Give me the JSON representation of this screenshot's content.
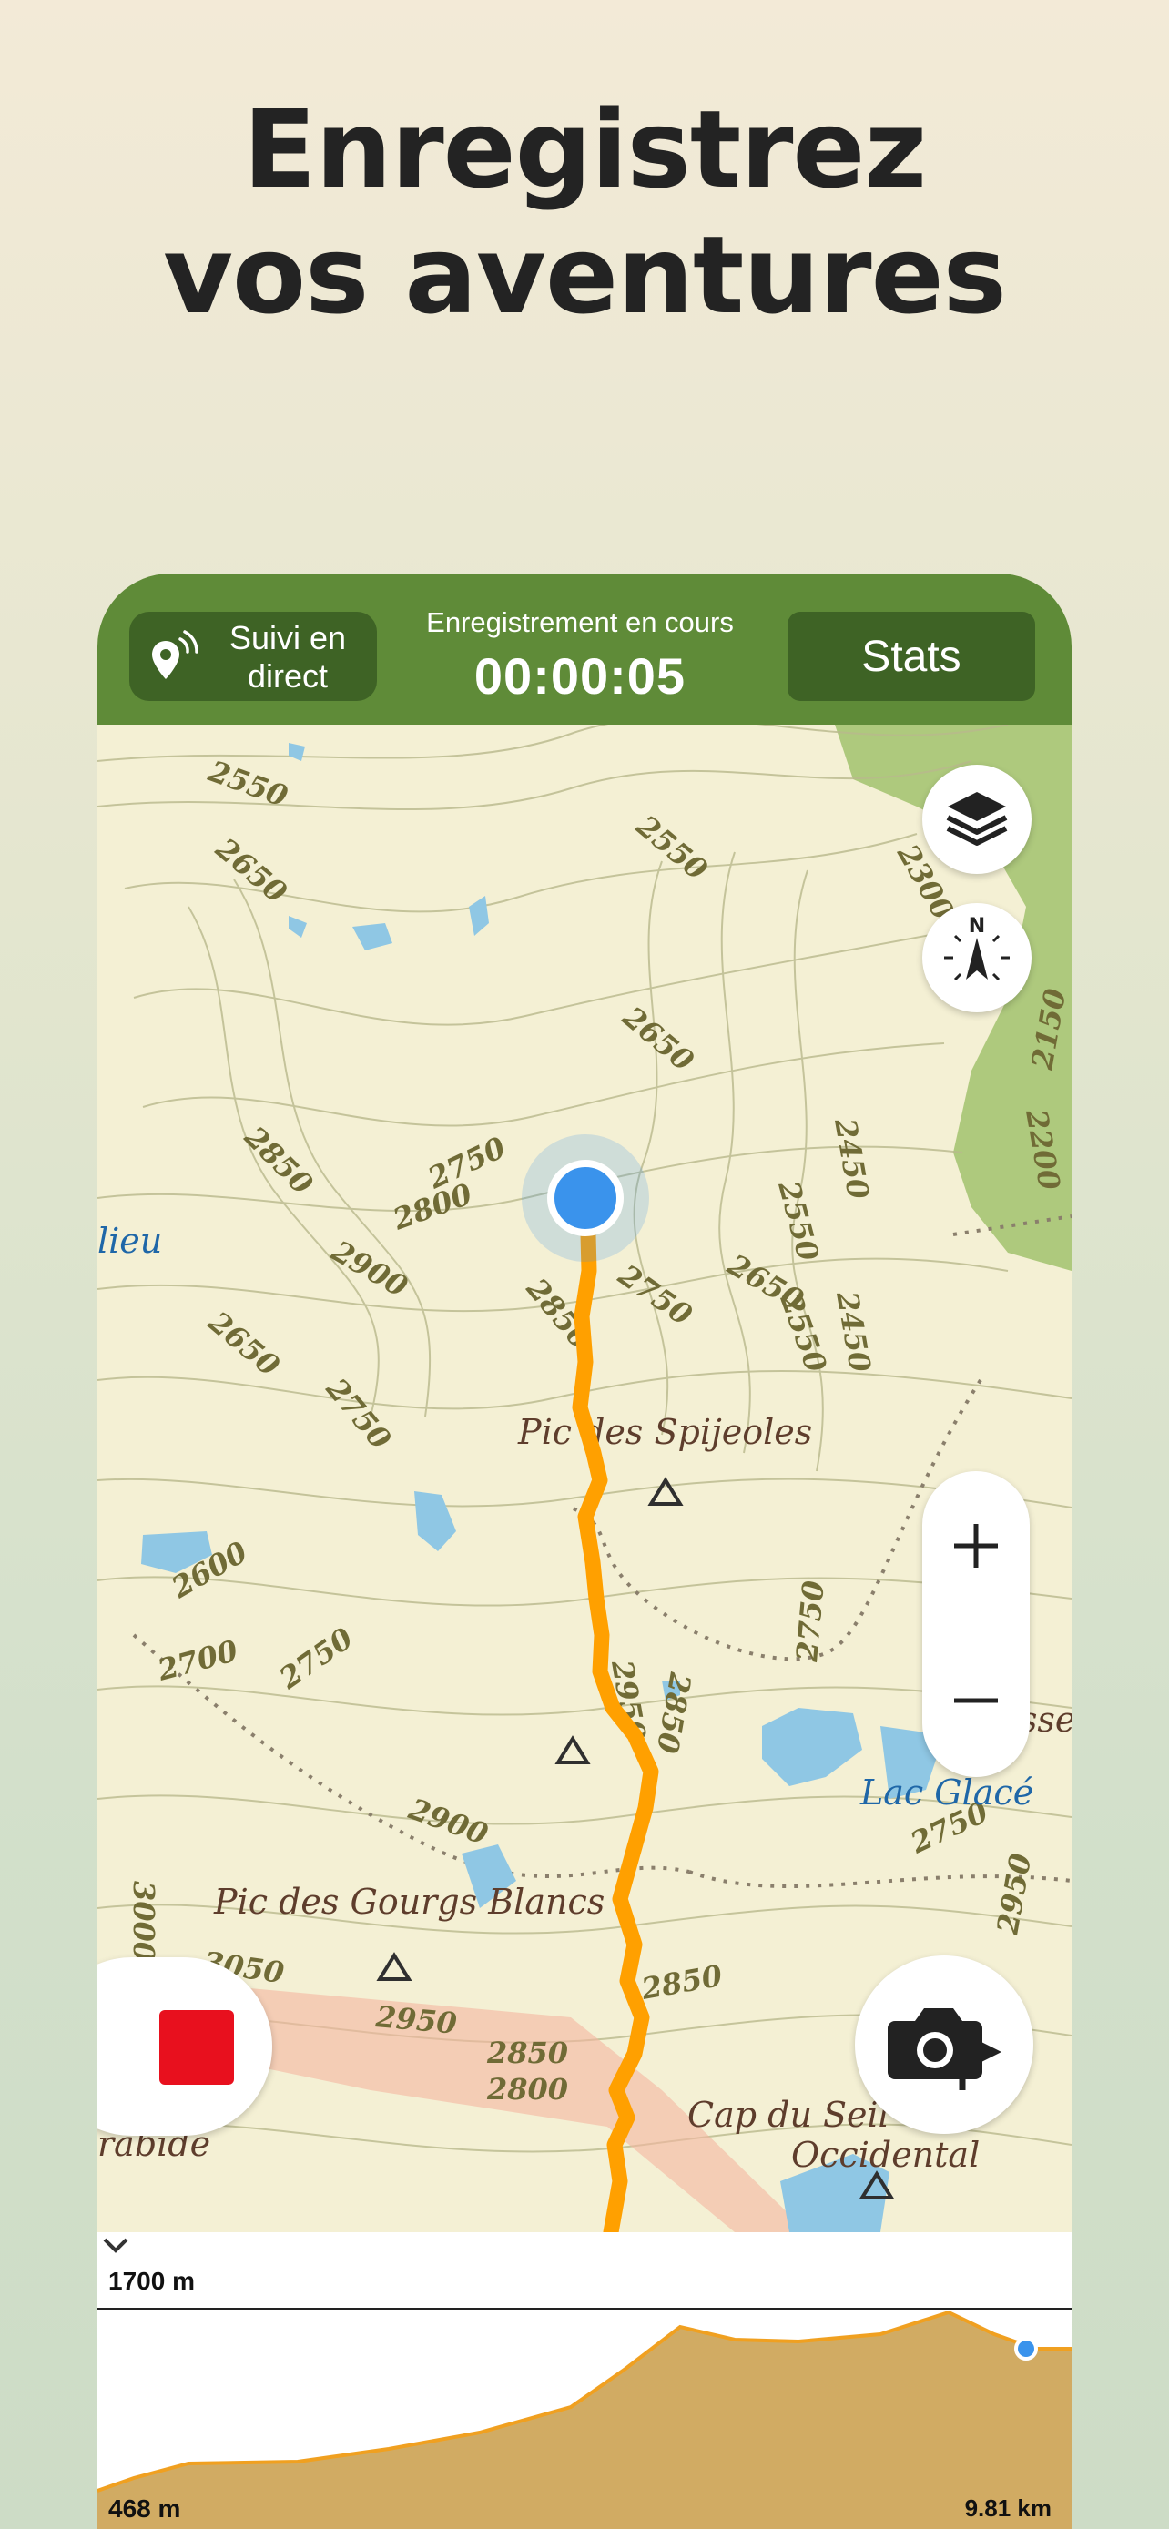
{
  "headline": {
    "line1": "Enregistrez",
    "line2": "vos aventures"
  },
  "topbar": {
    "live_tracking_label": "Suivi en direct",
    "recording_status": "Enregistrement en cours",
    "timer": "00:00:05",
    "stats_label": "Stats"
  },
  "map": {
    "place_labels": [
      "Pic des Spijeoles",
      "Pic des Gourgs Blancs",
      "Lac Glacé",
      "Tusse",
      "Cap du Seil",
      "Occidental",
      "lieu",
      "rabide"
    ],
    "contour_labels": [
      "2550",
      "2650",
      "2550",
      "2650",
      "2450",
      "2300",
      "2850",
      "2750",
      "2800",
      "2900",
      "2850",
      "2750",
      "2650",
      "2550",
      "2450",
      "2550",
      "2650",
      "2750",
      "2600",
      "2700",
      "2750",
      "2900",
      "2950",
      "2850",
      "2750",
      "2750",
      "3050",
      "2950",
      "2850",
      "2800",
      "2850",
      "3000",
      "2950",
      "2150",
      "2200"
    ],
    "icons": [
      "layers-icon",
      "compass-icon",
      "zoom-in-icon",
      "zoom-out-icon",
      "stop-icon",
      "camera-flag-icon"
    ],
    "colors": {
      "track": "#ffa000",
      "position": "#3a93ec",
      "topbar": "#5f8b38",
      "stop": "#e8101e"
    }
  },
  "elevation": {
    "max_label": "1700 m",
    "min_label": "468 m",
    "distance_label": "9.81 km"
  }
}
